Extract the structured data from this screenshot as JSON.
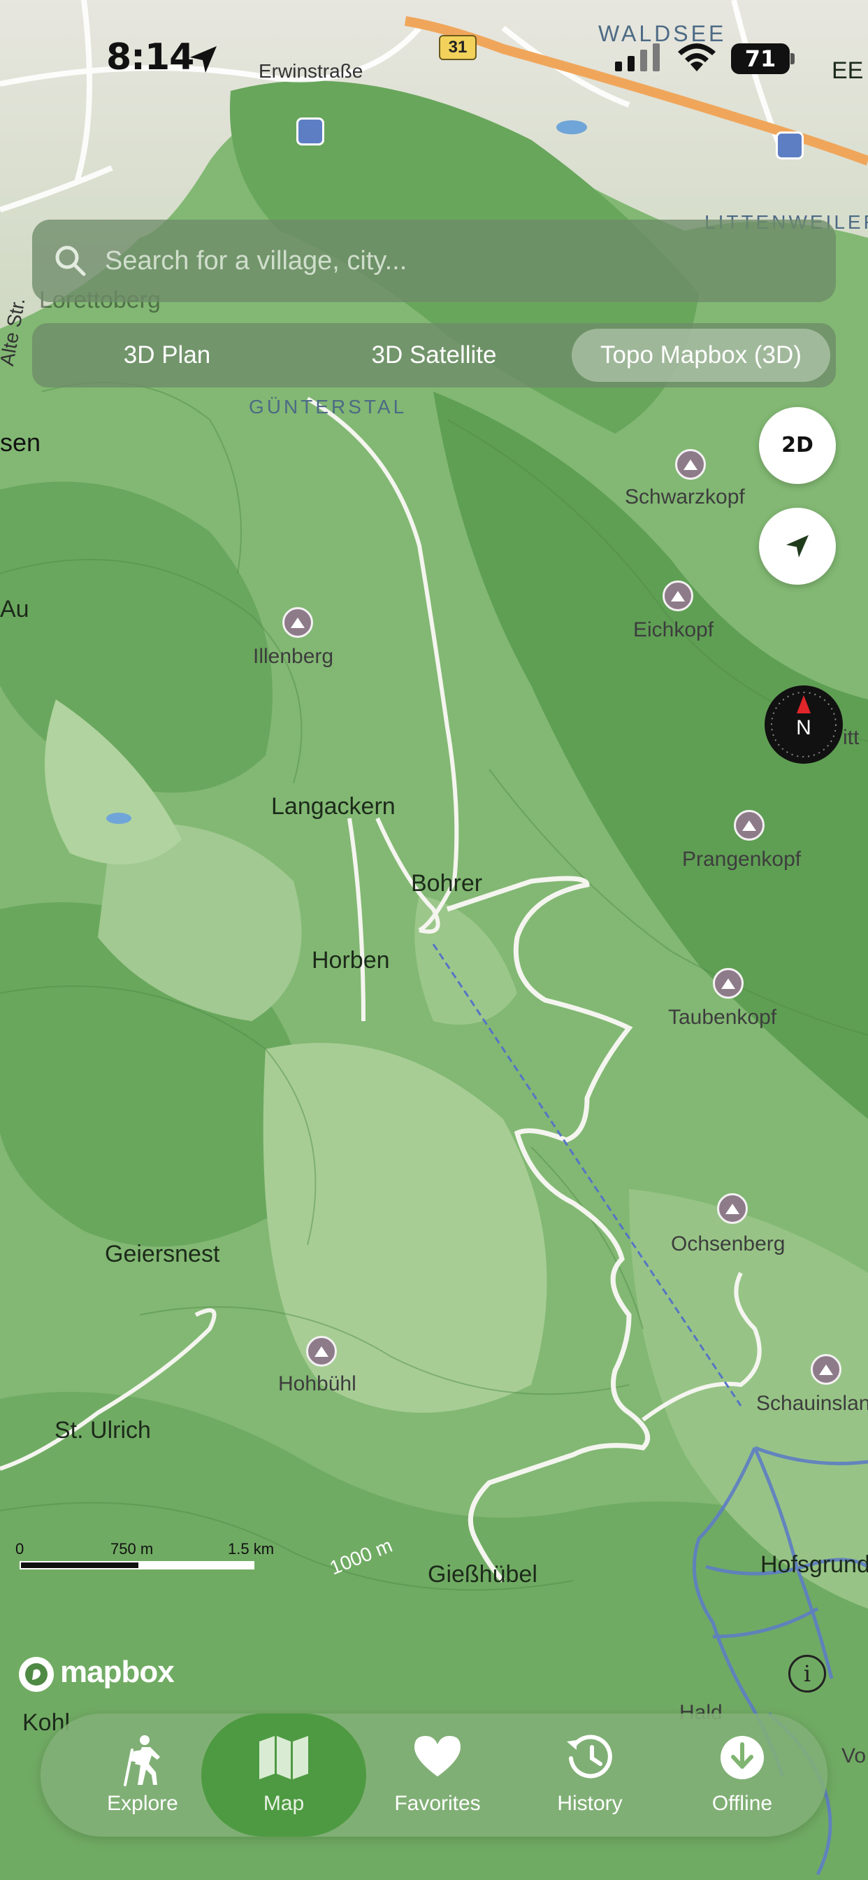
{
  "status_bar": {
    "time": "8:14",
    "battery": "71"
  },
  "search": {
    "placeholder": "Search for a village, city..."
  },
  "map_modes": [
    {
      "label": "3D Plan",
      "selected": false
    },
    {
      "label": "3D Satellite",
      "selected": false
    },
    {
      "label": "Topo Mapbox (3D)",
      "selected": true
    }
  ],
  "controls": {
    "dimension_toggle": "2D",
    "compass_label": "N"
  },
  "map": {
    "road_number": "31",
    "streets": [
      "Erwinstraße",
      "Alte Str."
    ],
    "districts": [
      "WALDSEE",
      "LITTENWEILER",
      "GÜNTERSTAL"
    ],
    "places": [
      {
        "name": "Langackern"
      },
      {
        "name": "Bohrer"
      },
      {
        "name": "Horben"
      },
      {
        "name": "Geiersnest"
      },
      {
        "name": "St. Ulrich"
      },
      {
        "name": "Gießhübel"
      },
      {
        "name": "Hofsgrund"
      },
      {
        "name": "sen"
      },
      {
        "name": "Au"
      },
      {
        "name": "Kohl"
      },
      {
        "name": "Lorettoberg"
      }
    ],
    "peaks": [
      {
        "name": "Schwarzkopf"
      },
      {
        "name": "Eichkopf"
      },
      {
        "name": "Illenberg"
      },
      {
        "name": "Prangenkopf"
      },
      {
        "name": "Taubenkopf"
      },
      {
        "name": "Ochsenberg"
      },
      {
        "name": "Hohbühl"
      },
      {
        "name": "Schauinsland"
      }
    ],
    "contour_label": "1000 m",
    "edge_labels": [
      "EE",
      "itt",
      "Vo",
      "Hald"
    ]
  },
  "scale": {
    "zero": "0",
    "mid": "750 m",
    "max": "1.5 km"
  },
  "attribution": {
    "brand": "mapbox"
  },
  "tabs": [
    {
      "label": "Explore",
      "icon": "hiker-icon"
    },
    {
      "label": "Map",
      "icon": "map-icon",
      "active": true
    },
    {
      "label": "Favorites",
      "icon": "heart-icon"
    },
    {
      "label": "History",
      "icon": "history-icon"
    },
    {
      "label": "Offline",
      "icon": "download-icon"
    }
  ],
  "colors": {
    "map_green_dark": "#5f9c56",
    "map_green_light": "#a9cf98",
    "active_tab": "#4e9a42",
    "road_highlight": "#f0a65a",
    "transit_blue": "#5e7ec4"
  }
}
